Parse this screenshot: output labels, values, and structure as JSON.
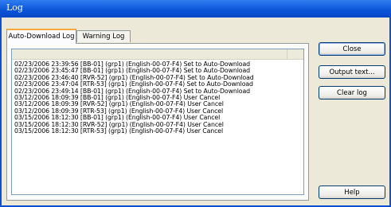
{
  "window": {
    "title": "Log"
  },
  "tabs": [
    {
      "label": "Auto-Download Log",
      "active": true
    },
    {
      "label": "Warning Log",
      "active": false
    }
  ],
  "log_entries": [
    "02/23/2006 23:39:56 [BB-01] (grp1) (English-00-07-F4) Set to Auto-Download",
    "02/23/2006 23:45:47 [BB-01] (grp1) (English-00-07-F4) Set to Auto-Download",
    "02/23/2006 23:46:40 [RVR-52] (grp1) (English-00-07-F4) Set to Auto-Download",
    "02/23/2006 23:47:04 [RTR-53] (grp1) (English-00-07-F4) Set to Auto-Download",
    "02/23/2006 23:49:14 [BB-01] (grp1) (English-00-07-F4) Set to Auto-Download",
    "03/12/2006 18:09:39 [BB-01] (grp1) (English-00-07-F4) User Cancel",
    "03/12/2006 18:09:39 [RVR-52] (grp1) (English-00-07-F4) User Cancel",
    "03/12/2006 18:09:39 [RTR-53] (grp1) (English-00-07-F4) User Cancel",
    "03/15/2006 18:12:30 [BB-01] (grp1) (English-00-07-F4) User Cancel",
    "03/15/2006 18:12:30 [RVR-52] (grp1) (English-00-07-F4) User Cancel",
    "03/15/2006 18:12:30 [RTR-53] (grp1) (English-00-07-F4) User Cancel"
  ],
  "buttons": {
    "close": "Close",
    "output_text": "Output text...",
    "clear_log": "Clear log",
    "help": "Help"
  },
  "colors": {
    "titlebar": "#0a54d8",
    "dialog_face": "#ece9d8",
    "active_tab_accent": "#f7a93b"
  }
}
